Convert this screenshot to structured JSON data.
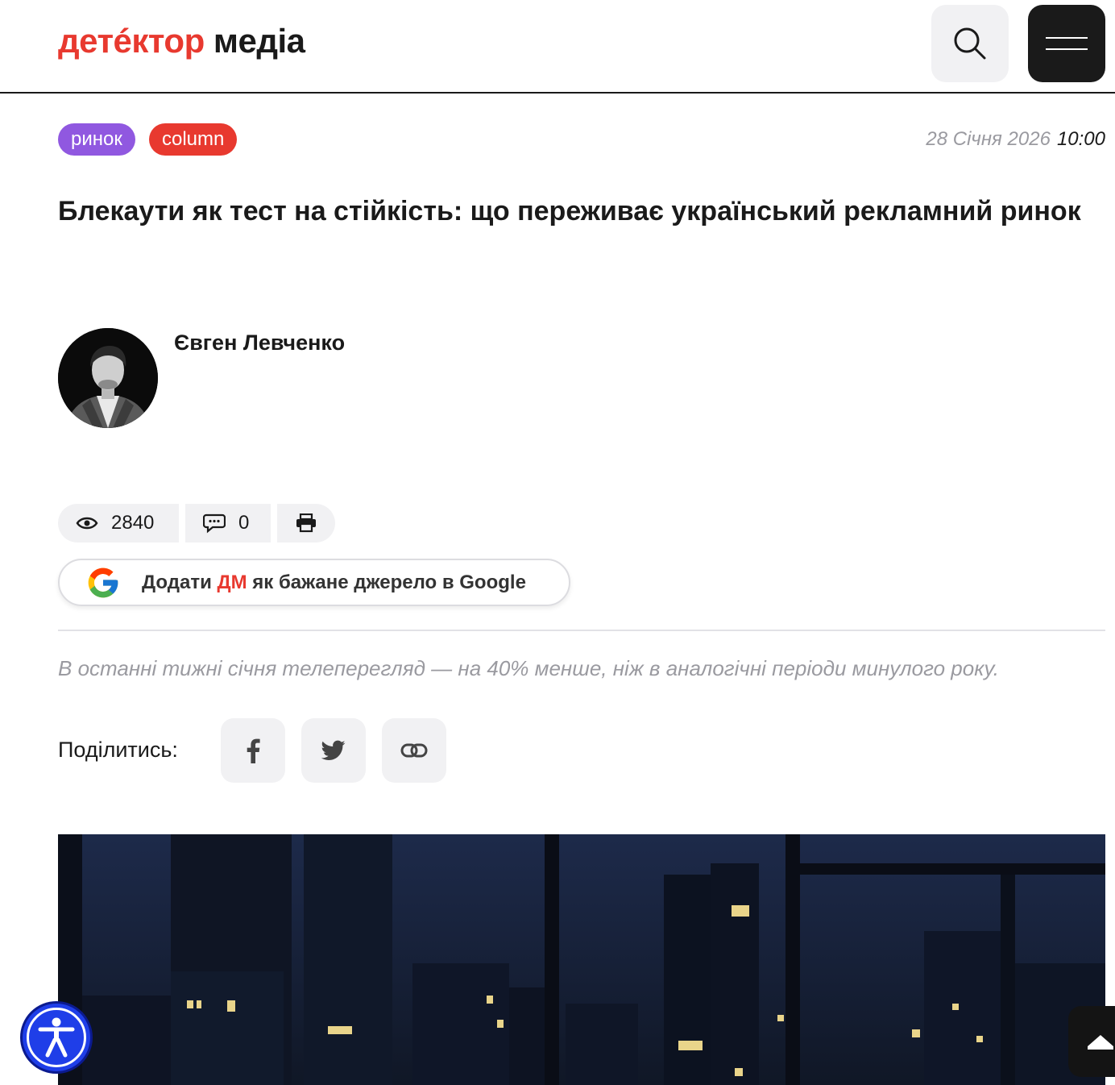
{
  "header": {
    "logo_part1": "детéктор",
    "logo_part2": "медіа",
    "search_icon": "search-icon",
    "menu_icon": "hamburger-menu-icon"
  },
  "article": {
    "tags": [
      "ринок",
      "column"
    ],
    "date": "28 Січня 2026",
    "time": "10:00",
    "title": "Блекаути як тест на стійкість: що переживає український рекламний ринок",
    "author": "Євген Левченко",
    "views": "2840",
    "comments": "0",
    "lead": "В останні тижні січня теле­перегляд — на 40% менше, ніж в аналогічні періоди минулого року."
  },
  "google_source": {
    "prefix": "Додати",
    "brand": "ДМ",
    "suffix": "як бажане джерело в Google"
  },
  "share": {
    "label": "Поділитись:",
    "icons": [
      "facebook-icon",
      "twitter-icon",
      "link-icon"
    ]
  },
  "colors": {
    "brand_red": "#e8392f",
    "tag_purple": "#9058e0",
    "dark": "#1a1a1a",
    "muted": "#9a9aa0",
    "accessibility_blue": "#1f3ee8"
  }
}
